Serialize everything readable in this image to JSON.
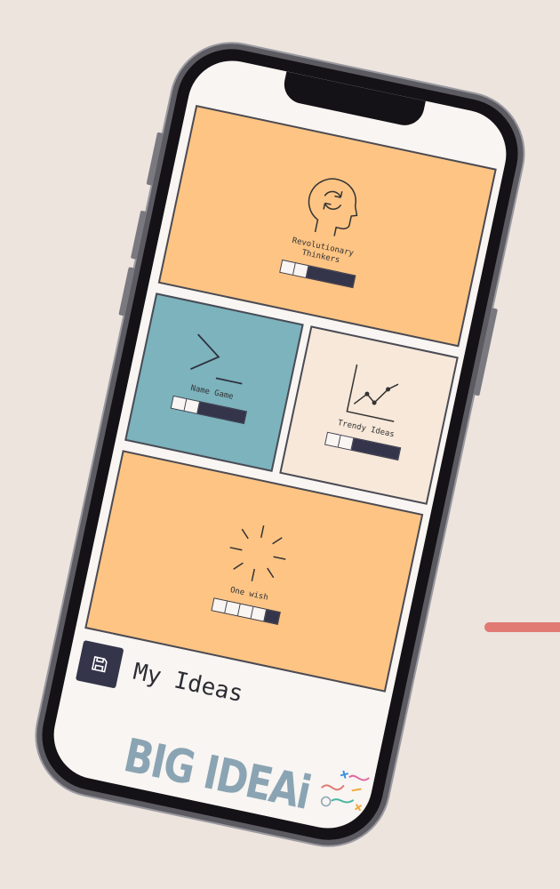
{
  "colors": {
    "background": "#ece4dd",
    "card_orange": "#fdc484",
    "card_blue": "#7cb3bd",
    "card_cream": "#f7e8d9",
    "dark_navy": "#34344a",
    "screen": "#f8f5f2",
    "accent_line": "#e07a72",
    "logo_blue": "#8aa4b3"
  },
  "cards": [
    {
      "label": "Revolutionary Thinkers",
      "icon": "head-refresh-icon",
      "progress_filled": 1,
      "progress_total": 3
    },
    {
      "label": "Name Game",
      "icon": "terminal-prompt-icon",
      "progress_filled": 1,
      "progress_total": 3
    },
    {
      "label": "Trendy Ideas",
      "icon": "line-chart-icon",
      "progress_filled": 1,
      "progress_total": 3
    },
    {
      "label": "One wish",
      "icon": "sparkle-burst-icon",
      "progress_filled": 4,
      "progress_total": 5
    }
  ],
  "my_ideas": {
    "label": "My Ideas",
    "icon": "save-icon"
  },
  "logo": {
    "text": "BIG IDEAi"
  }
}
